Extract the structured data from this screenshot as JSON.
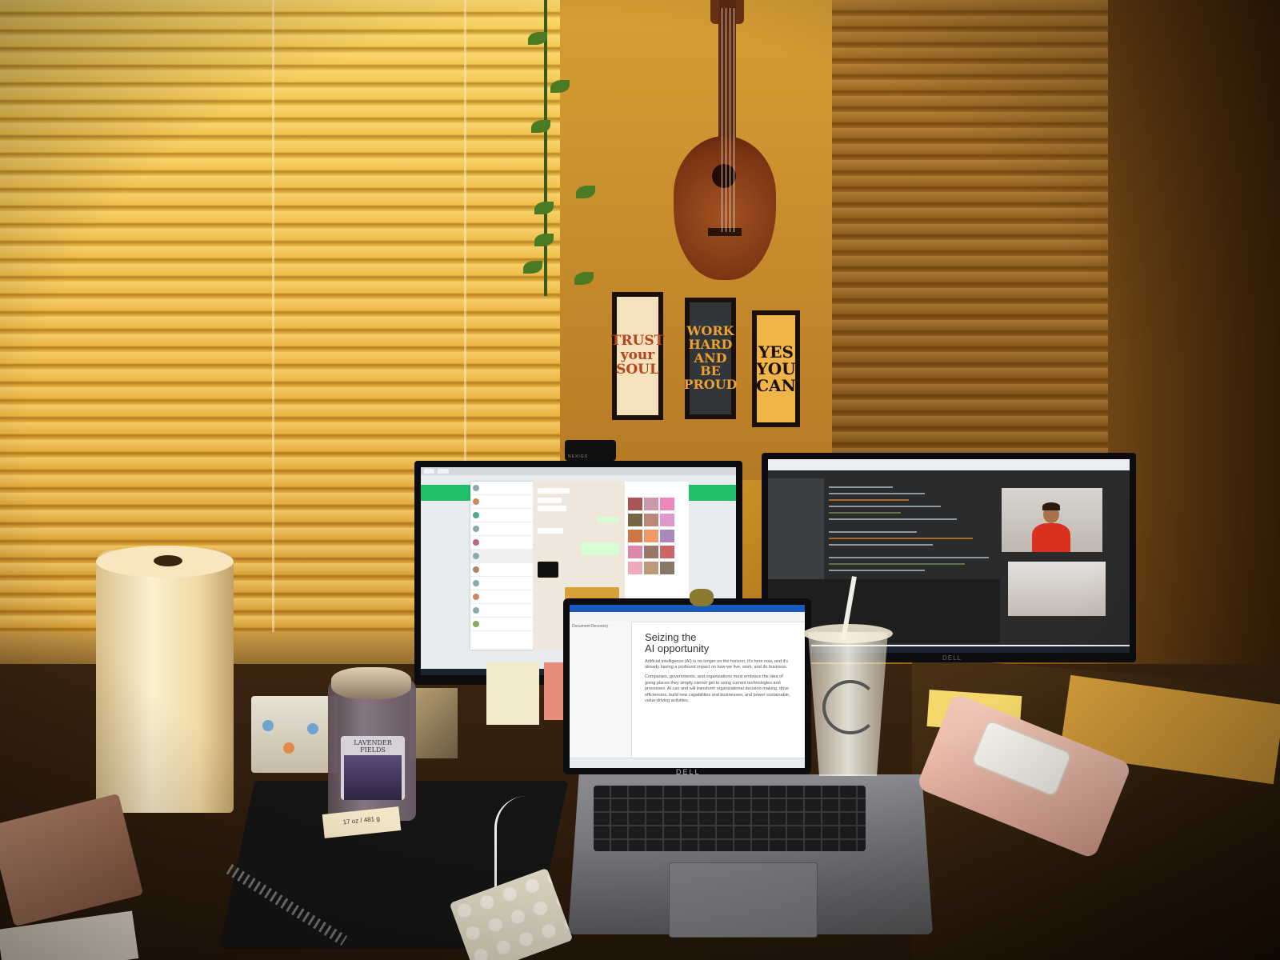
{
  "posters": {
    "poster1": "TRUST your SOUL",
    "poster2": "WORK HARD AND BE PROUD",
    "poster3": "YES YOU CAN"
  },
  "webcam_brand": "NEXIGO",
  "laptop_doc": {
    "pane_title": "Document Recovery",
    "title_line1": "Seizing the",
    "title_line2": "AI opportunity",
    "paragraph1": "Artificial intelligence (AI) is no longer on the horizon. It's here now, and it's already having a profound impact on how we live, work, and do business.",
    "paragraph2": "Companies, governments, and organizations must embrace the idea of going places they simply cannot get to using current technologies and processes. AI can and will transform organizational decision-making, drive efficiencies, build new capabilities and businesses, and power sustainable, value-driving activities."
  },
  "brands": {
    "laptop": "DELL",
    "monitor": "DELL"
  },
  "candle": {
    "label": "LAVENDER FIELDS",
    "weight": "17 oz / 481 g"
  },
  "colors": {
    "wall": "#d79e34",
    "blinds": "#f4c84a",
    "desk": "#2a1a0c",
    "chat_accent": "#1fbf6a",
    "word_accent": "#185abd"
  }
}
